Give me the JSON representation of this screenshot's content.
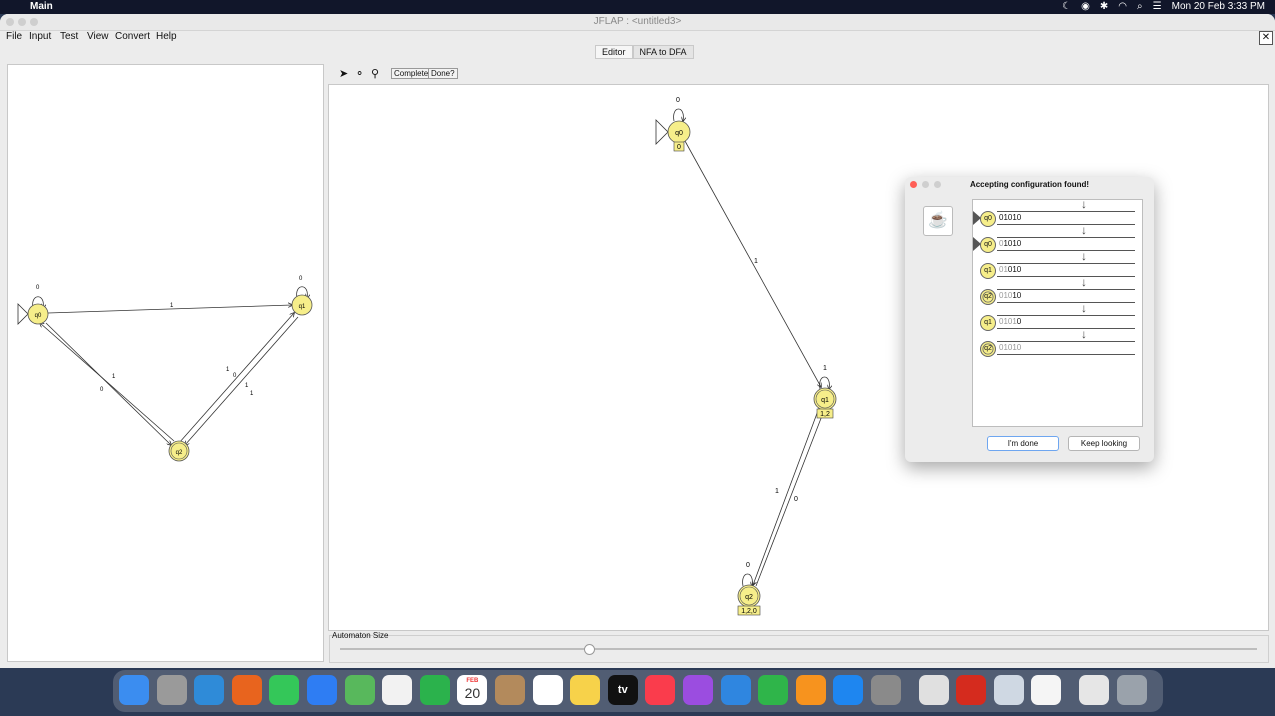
{
  "menubar": {
    "app_name": "Main",
    "clock": "Mon 20 Feb  3:33 PM"
  },
  "window": {
    "title": "JFLAP : <untitled3>",
    "menus": [
      "File",
      "Input",
      "Test",
      "View",
      "Convert",
      "Help"
    ],
    "close_label": "✕",
    "tabs": [
      {
        "label": "Editor",
        "active": false
      },
      {
        "label": "NFA to DFA",
        "active": true
      }
    ]
  },
  "toolbar": {
    "complete_label": "Complete",
    "done_label": "Done?"
  },
  "nfa": {
    "states": [
      "q0",
      "q1",
      "q2"
    ],
    "labels": {
      "q0_loop": "0",
      "q1_loop": "0",
      "q0_q1": "1",
      "q0_q2": "1",
      "q2_q0": "0",
      "q2_q1_a": "1",
      "q2_q1_b": "0",
      "q1_q2": "1"
    }
  },
  "dfa": {
    "states": [
      {
        "name": "q0",
        "label": "0"
      },
      {
        "name": "q1",
        "label": "1,2"
      },
      {
        "name": "q2",
        "label": "1,2,0"
      }
    ],
    "labels": {
      "q0_loop": "0",
      "q0_q1": "1",
      "q1_loop": "1",
      "q1_q2": "1",
      "q2_q1": "0",
      "q2_loop": "0"
    }
  },
  "automaton_size_label": "Automaton Size",
  "automaton_size_fraction": 0.27,
  "dialog": {
    "title": "Accepting configuration found!",
    "configs": [
      {
        "state": "q0",
        "start": true,
        "consumed": "",
        "remaining": "01010",
        "final": false
      },
      {
        "state": "q0",
        "start": true,
        "consumed": "0",
        "remaining": "1010",
        "final": false
      },
      {
        "state": "q1",
        "start": false,
        "consumed": "01",
        "remaining": "010",
        "final": false
      },
      {
        "state": "q2",
        "start": false,
        "consumed": "010",
        "remaining": "10",
        "final": true
      },
      {
        "state": "q1",
        "start": false,
        "consumed": "0101",
        "remaining": "0",
        "final": false
      },
      {
        "state": "q2",
        "start": false,
        "consumed": "01010",
        "remaining": "",
        "final": true
      }
    ],
    "done_label": "I'm done",
    "keep_label": "Keep looking"
  },
  "dock": {
    "calendar_month": "FEB",
    "calendar_day": "20",
    "tv_label": "tv",
    "icons": [
      "finder-icon",
      "launchpad-icon",
      "safari-icon",
      "firefox-icon",
      "messages-icon",
      "mail-icon",
      "maps-icon",
      "photos-icon",
      "facetime-icon",
      "calendar-icon",
      "contacts-icon",
      "reminders-icon",
      "notes-icon",
      "appletv-icon",
      "music-icon",
      "podcasts-icon",
      "keynote-icon",
      "numbers-icon",
      "pages-icon",
      "appstore-icon",
      "settings-icon",
      "chrome-icon",
      "acrobat-icon",
      "preview-icon",
      "java-icon",
      "documents-icon",
      "trash-icon"
    ],
    "colors": {
      "finder": "#3b8df0",
      "launchpad": "#9a9a9a",
      "safari": "#2f8bd8",
      "firefox": "#e8641e",
      "messages": "#34c759",
      "mail": "#2e7df3",
      "maps": "#58b85c",
      "photos": "#f2f2f2",
      "facetime": "#2bb24c",
      "calendar": "#ffffff",
      "contacts": "#b38a5c",
      "reminders": "#ffffff",
      "notes": "#f7d24a",
      "appletv": "#111111",
      "music": "#fa3c4c",
      "podcasts": "#9b4de0",
      "keynote": "#2f86e0",
      "numbers": "#2fb54a",
      "pages": "#f7931e",
      "appstore": "#1e86f0",
      "settings": "#8a8a8a",
      "chrome": "#e0e0e0",
      "acrobat": "#d52b1e",
      "preview": "#cfd8e3",
      "java": "#f5f5f5",
      "documents": "#e6e6e6",
      "trash": "#9aa2ab"
    }
  }
}
